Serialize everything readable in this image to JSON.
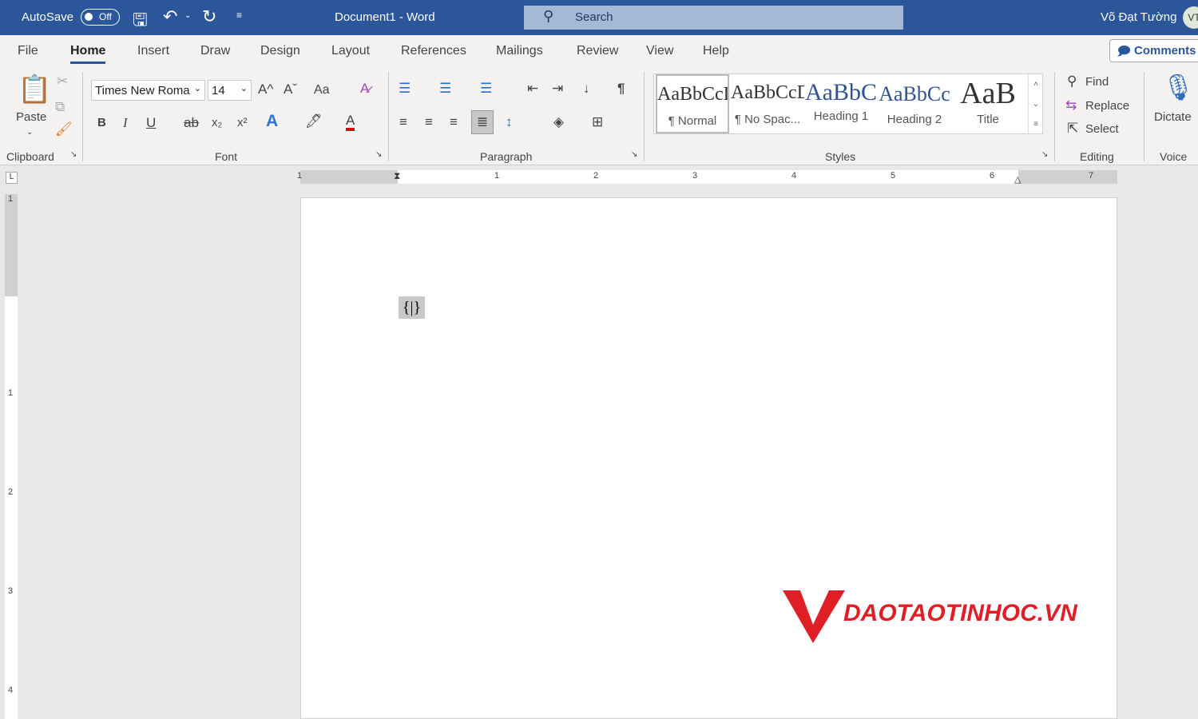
{
  "titlebar": {
    "autosave_label": "AutoSave",
    "autosave_state": "Off",
    "doc_title": "Document1  -  Word",
    "search_placeholder": "Search",
    "user_name": "Võ Đạt Tường",
    "user_initials": "VT"
  },
  "tabs": [
    "File",
    "Home",
    "Insert",
    "Draw",
    "Design",
    "Layout",
    "References",
    "Mailings",
    "Review",
    "View",
    "Help"
  ],
  "active_tab": "Home",
  "comments_label": "Comments",
  "clipboard": {
    "paste": "Paste",
    "group": "Clipboard"
  },
  "font": {
    "name": "Times New Roma",
    "size": "14",
    "group": "Font",
    "grow": "A^",
    "shrink": "Aˇ",
    "case": "Aa",
    "bold": "B",
    "italic": "I",
    "underline": "U",
    "strike": "ab",
    "sub": "x₂",
    "sup": "x²",
    "font_color": "#e00000"
  },
  "paragraph": {
    "group": "Paragraph"
  },
  "styles": {
    "group": "Styles",
    "items": [
      {
        "preview": "AaBbCcDc",
        "name": "¶ Normal",
        "color": "#000"
      },
      {
        "preview": "AaBbCcDc",
        "name": "¶ No Spac...",
        "color": "#000"
      },
      {
        "preview": "AaBbC",
        "name": "Heading 1",
        "color": "#2f5496"
      },
      {
        "preview": "AaBbCc",
        "name": "Heading 2",
        "color": "#2f5496"
      },
      {
        "preview": "AaB",
        "name": "Title",
        "color": "#000"
      }
    ]
  },
  "editing": {
    "find": "Find",
    "replace": "Replace",
    "select": "Select",
    "group": "Editing"
  },
  "voice": {
    "dictate": "Dictate",
    "group": "Voice"
  },
  "ruler": {
    "numbers": [
      "1",
      "1",
      "2",
      "3",
      "4",
      "5",
      "6",
      "7"
    ],
    "vnumbers": [
      "1",
      "1",
      "2",
      "3",
      "4"
    ]
  },
  "document": {
    "field_code": "{|}"
  },
  "watermark": {
    "text": "DAOTAOTINHOC.VN"
  }
}
